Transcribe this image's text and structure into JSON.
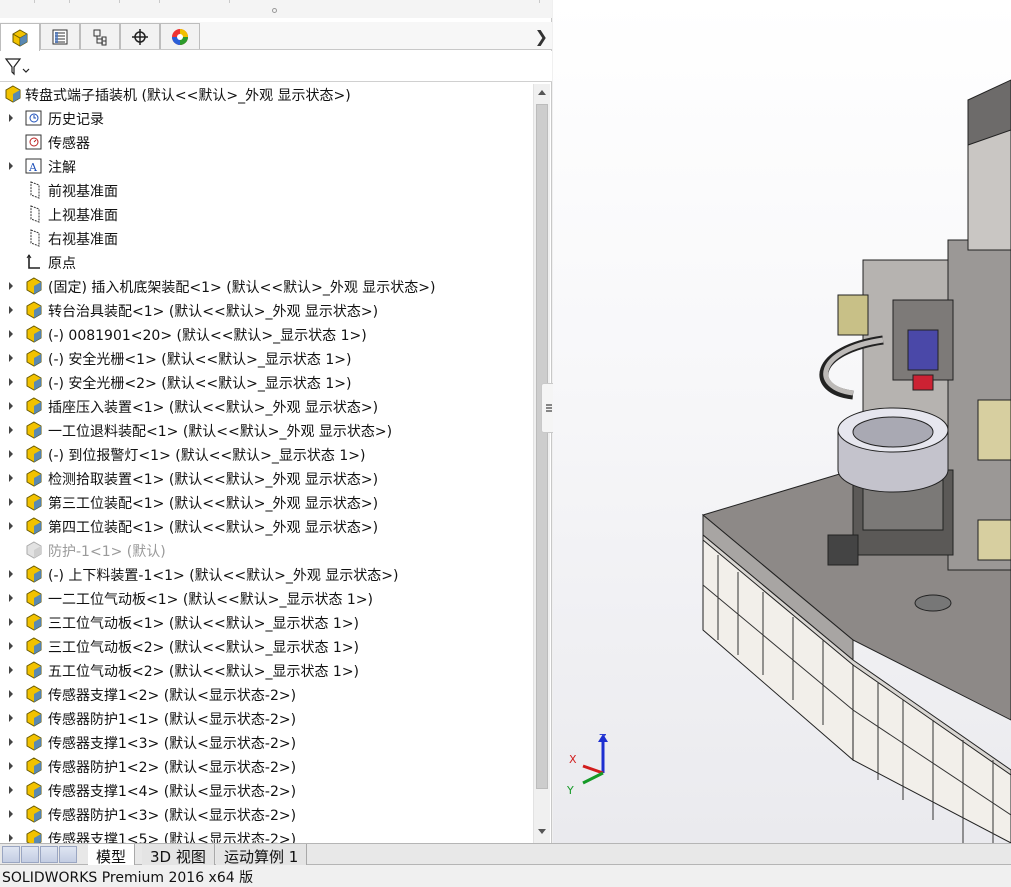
{
  "manager_tabs": [
    {
      "icon": "feature-manager-icon",
      "active": true
    },
    {
      "icon": "property-manager-icon"
    },
    {
      "icon": "configuration-manager-icon"
    },
    {
      "icon": "dimxpert-manager-icon"
    },
    {
      "icon": "display-manager-icon"
    }
  ],
  "filter_icon": "filter-icon",
  "tree": {
    "root": "转盘式端子插装机  (默认<<默认>_外观 显示状态>)",
    "items": [
      {
        "label": "历史记录",
        "icon": "history-icon",
        "expand": true
      },
      {
        "label": "传感器",
        "icon": "sensor-icon",
        "expand": false
      },
      {
        "label": "注解",
        "icon": "annotation-icon",
        "expand": true
      },
      {
        "label": "前视基准面",
        "icon": "plane-icon",
        "expand": false
      },
      {
        "label": "上视基准面",
        "icon": "plane-icon",
        "expand": false
      },
      {
        "label": "右视基准面",
        "icon": "plane-icon",
        "expand": false
      },
      {
        "label": "原点",
        "icon": "origin-icon",
        "expand": false
      },
      {
        "label": "(固定) 插入机底架装配<1> (默认<<默认>_外观 显示状态>)",
        "icon": "subassembly-icon",
        "expand": true
      },
      {
        "label": "转台治具装配<1> (默认<<默认>_外观 显示状态>)",
        "icon": "subassembly-icon",
        "expand": true
      },
      {
        "label": "(-) 0081901<20> (默认<<默认>_显示状态 1>)",
        "icon": "subassembly-icon",
        "expand": true
      },
      {
        "label": "(-) 安全光栅<1> (默认<<默认>_显示状态 1>)",
        "icon": "subassembly-icon",
        "expand": true
      },
      {
        "label": "(-) 安全光栅<2> (默认<<默认>_显示状态 1>)",
        "icon": "subassembly-icon",
        "expand": true
      },
      {
        "label": "插座压入装置<1> (默认<<默认>_外观 显示状态>)",
        "icon": "subassembly-icon",
        "expand": true
      },
      {
        "label": "一工位退料装配<1> (默认<<默认>_外观 显示状态>)",
        "icon": "subassembly-icon",
        "expand": true
      },
      {
        "label": "(-) 到位报警灯<1> (默认<<默认>_显示状态 1>)",
        "icon": "subassembly-icon",
        "expand": true
      },
      {
        "label": "检测拾取装置<1> (默认<<默认>_外观 显示状态>)",
        "icon": "subassembly-icon",
        "expand": true
      },
      {
        "label": "第三工位装配<1> (默认<<默认>_外观 显示状态>)",
        "icon": "subassembly-icon",
        "expand": true
      },
      {
        "label": "第四工位装配<1> (默认<<默认>_外观 显示状态>)",
        "icon": "subassembly-icon",
        "expand": true
      },
      {
        "label": "防护-1<1> (默认)",
        "icon": "suppressed-part-icon",
        "expand": false,
        "dim": true
      },
      {
        "label": "(-) 上下料装置-1<1> (默认<<默认>_外观 显示状态>)",
        "icon": "subassembly-icon",
        "expand": true
      },
      {
        "label": "一二工位气动板<1> (默认<<默认>_显示状态 1>)",
        "icon": "subassembly-icon",
        "expand": true
      },
      {
        "label": "三工位气动板<1> (默认<<默认>_显示状态 1>)",
        "icon": "subassembly-icon",
        "expand": true
      },
      {
        "label": "三工位气动板<2> (默认<<默认>_显示状态 1>)",
        "icon": "subassembly-icon",
        "expand": true
      },
      {
        "label": "五工位气动板<2> (默认<<默认>_显示状态 1>)",
        "icon": "subassembly-icon",
        "expand": true
      },
      {
        "label": "传感器支撑1<2> (默认<显示状态-2>)",
        "icon": "subassembly-icon",
        "expand": true
      },
      {
        "label": "传感器防护1<1> (默认<显示状态-2>)",
        "icon": "subassembly-icon",
        "expand": true
      },
      {
        "label": "传感器支撑1<3> (默认<显示状态-2>)",
        "icon": "subassembly-icon",
        "expand": true
      },
      {
        "label": "传感器防护1<2> (默认<显示状态-2>)",
        "icon": "subassembly-icon",
        "expand": true
      },
      {
        "label": "传感器支撑1<4> (默认<显示状态-2>)",
        "icon": "subassembly-icon",
        "expand": true
      },
      {
        "label": "传感器防护1<3> (默认<显示状态-2>)",
        "icon": "subassembly-icon",
        "expand": true
      },
      {
        "label": "传感器支撑1<5> (默认<显示状态-2>)",
        "icon": "subassembly-icon",
        "expand": true
      }
    ]
  },
  "triad": {
    "x": "X",
    "y": "Y",
    "z": "Z"
  },
  "bottom_tabs": [
    "模型",
    "3D 视图",
    "运动算例 1"
  ],
  "status_text": "SOLIDWORKS Premium 2016 x64 版"
}
